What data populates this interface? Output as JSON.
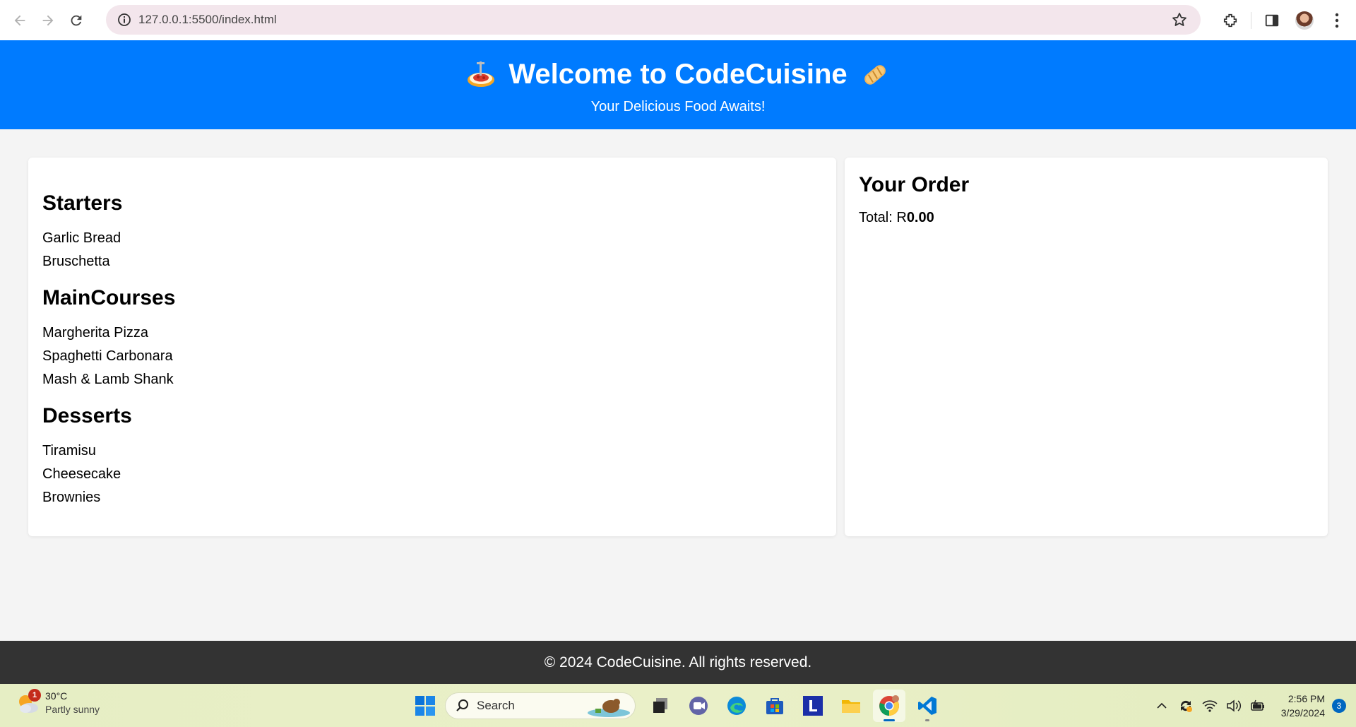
{
  "browser": {
    "url": "127.0.0.1:5500/index.html"
  },
  "header": {
    "title": "Welcome to CodeCuisine",
    "subtitle": "Your Delicious Food Awaits!",
    "left_emoji": "spaghetti-icon",
    "right_emoji": "bread-icon",
    "background_color": "#007bff"
  },
  "menu": {
    "categories": [
      {
        "name": "Starters",
        "items": [
          "Garlic Bread",
          "Bruschetta"
        ]
      },
      {
        "name": "MainCourses",
        "items": [
          "Margherita Pizza",
          "Spaghetti Carbonara",
          "Mash & Lamb Shank"
        ]
      },
      {
        "name": "Desserts",
        "items": [
          "Tiramisu",
          "Cheesecake",
          "Brownies"
        ]
      }
    ]
  },
  "order": {
    "title": "Your Order",
    "total_label": "Total: R",
    "total_value": "0.00"
  },
  "footer": {
    "text": "© 2024 CodeCuisine. All rights reserved.",
    "background_color": "#333333"
  },
  "taskbar": {
    "weather_temp": "30°C",
    "weather_condition": "Partly sunny",
    "weather_badge": "1",
    "search_placeholder": "Search",
    "time": "2:56 PM",
    "date": "3/29/2024",
    "notification_count": "3",
    "apps": [
      "file-viewer-icon",
      "teams-icon",
      "edge-icon",
      "store-icon",
      "l-app-icon",
      "file-explorer-icon",
      "chrome-icon",
      "vscode-icon"
    ]
  }
}
